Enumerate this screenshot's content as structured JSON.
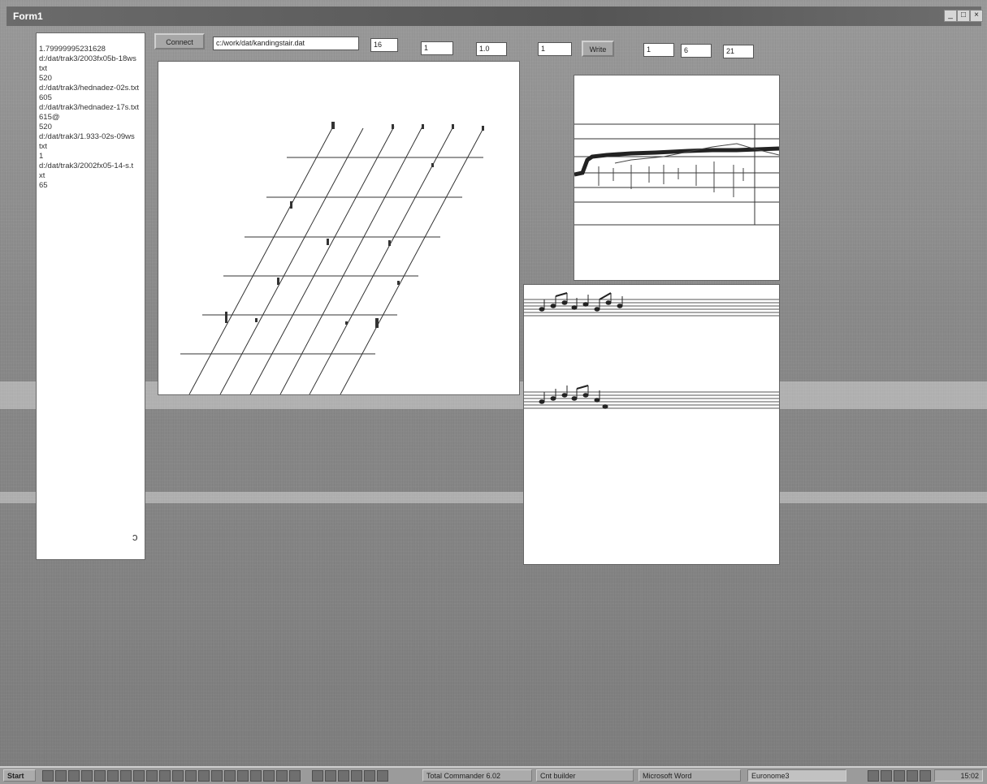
{
  "window": {
    "title": "Form1"
  },
  "list_items": [
    "1.79999995231628",
    "d:/dat/trak3/2003fx05b-18ws",
    "txt",
    "520",
    "d:/dat/trak3/hednadez-02s.txt",
    "605",
    "d:/dat/trak3/hednadez-17s.txt",
    "615@",
    "520",
    "d:/dat/trak3/1.933-02s-09ws",
    "txt",
    "1",
    "d:/dat/trak3/2002fx05-14-s.t",
    "xt",
    "65"
  ],
  "toolbar": {
    "button1": "Connect",
    "path": "c:/work/dat/kandingstair.dat",
    "field1": "16",
    "field2": "1",
    "field3": "1.0",
    "field4": "1",
    "button2": "Write",
    "field5": "1",
    "field6": "6",
    "field7": "21"
  },
  "taskbar": {
    "start": "Start",
    "task1": "Total Commander 6.02",
    "task2": "Cnt builder",
    "task3": "Microsoft Word",
    "task4": "Euronome3",
    "clock": "15:02"
  }
}
